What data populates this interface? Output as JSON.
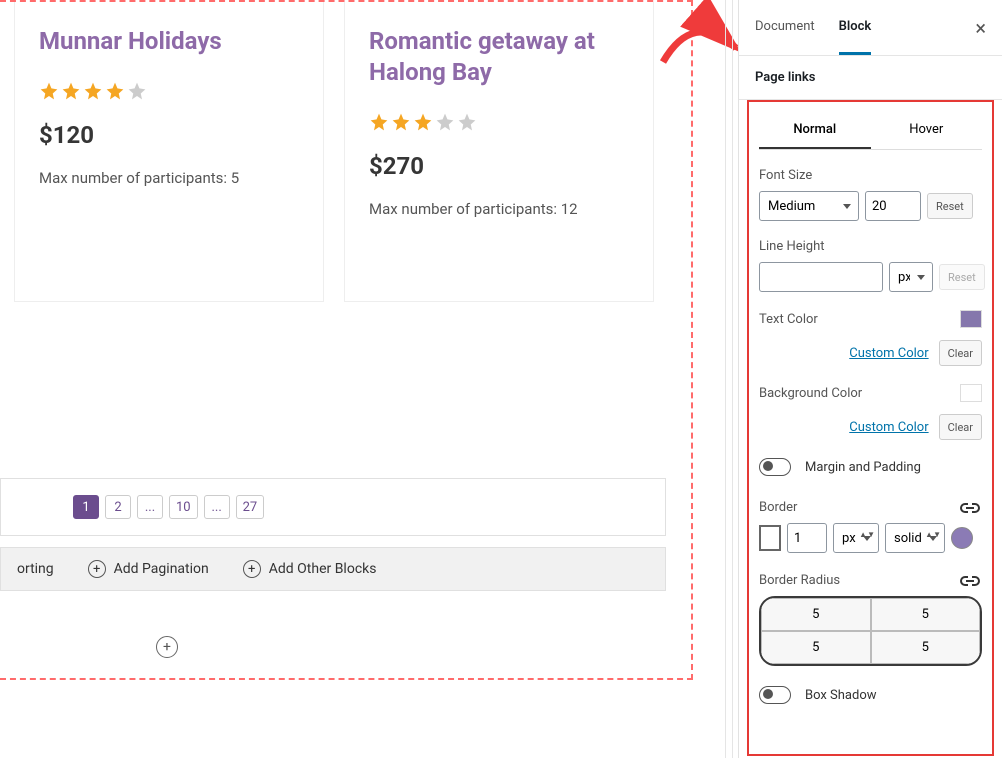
{
  "sidebar": {
    "tabs": {
      "document": "Document",
      "block": "Block"
    },
    "section_title": "Page links",
    "subtabs": {
      "normal": "Normal",
      "hover": "Hover"
    },
    "font_size": {
      "label": "Font Size",
      "preset": "Medium",
      "value": "20",
      "reset": "Reset"
    },
    "line_height": {
      "label": "Line Height",
      "value": "",
      "unit": "px",
      "reset": "Reset"
    },
    "text_color": {
      "label": "Text Color",
      "swatch": "#8577ac",
      "custom": "Custom Color",
      "clear": "Clear"
    },
    "bg_color": {
      "label": "Background Color",
      "swatch": "#ffffff",
      "custom": "Custom Color",
      "clear": "Clear"
    },
    "margin_padding": "Margin and Padding",
    "border": {
      "label": "Border",
      "width": "1",
      "unit": "px",
      "style": "solid"
    },
    "border_radius": {
      "label": "Border Radius",
      "tl": "5",
      "tr": "5",
      "bl": "5",
      "br": "5"
    },
    "box_shadow": "Box Shadow"
  },
  "cards": [
    {
      "title": "Munnar Holidays",
      "rating": 4,
      "price": "$120",
      "participants": "Max number of participants: 5"
    },
    {
      "title": "Romantic getaway at Halong Bay",
      "rating": 3,
      "price": "$270",
      "participants": "Max number of participants: 12"
    }
  ],
  "pagination": [
    "1",
    "2",
    "...",
    "10",
    "...",
    "27"
  ],
  "blocks_row": {
    "sorting": "orting",
    "pagination": "Add Pagination",
    "other": "Add Other Blocks"
  }
}
